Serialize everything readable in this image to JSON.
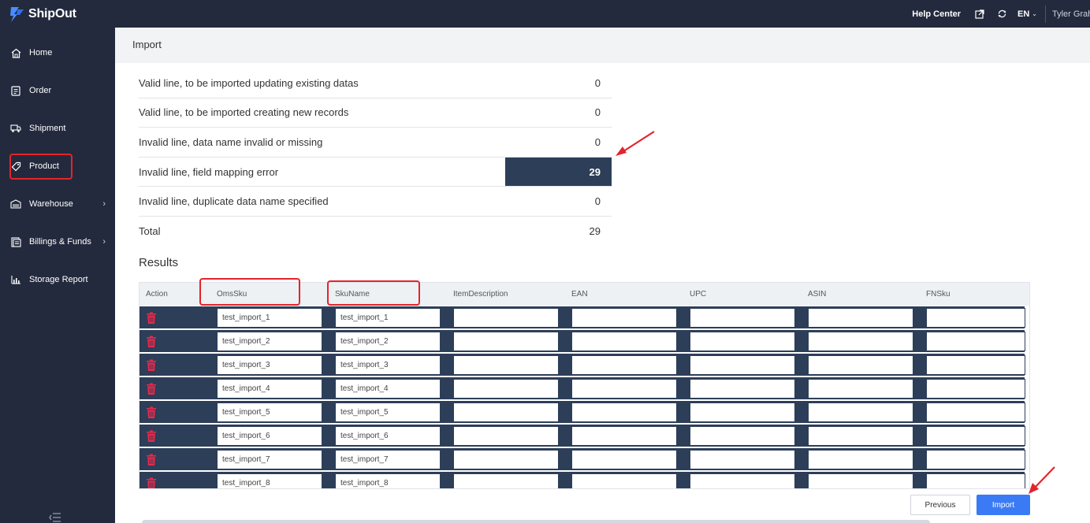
{
  "topbar": {
    "brand": "ShipOut",
    "help_center": "Help Center",
    "language": "EN",
    "user": "Tyler Graham"
  },
  "sidebar": {
    "items": [
      {
        "label": "Home",
        "icon": "home-icon"
      },
      {
        "label": "Order",
        "icon": "order-icon"
      },
      {
        "label": "Shipment",
        "icon": "shipment-icon"
      },
      {
        "label": "Product",
        "icon": "product-tag-icon"
      },
      {
        "label": "Warehouse",
        "icon": "warehouse-icon",
        "expandable": true
      },
      {
        "label": "Billings & Funds",
        "icon": "billing-icon",
        "expandable": true
      },
      {
        "label": "Storage Report",
        "icon": "storage-report-icon"
      }
    ]
  },
  "page": {
    "title": "Import"
  },
  "summary": [
    {
      "label": "Valid line, to be imported updating existing datas",
      "value": "0"
    },
    {
      "label": "Valid line, to be imported creating new records",
      "value": "0"
    },
    {
      "label": "Invalid line, data name invalid or missing",
      "value": "0"
    },
    {
      "label": "Invalid line, field mapping error",
      "value": "29",
      "active": true
    },
    {
      "label": "Invalid line, duplicate data name specified",
      "value": "0"
    },
    {
      "label": "Total",
      "value": "29"
    }
  ],
  "results": {
    "title": "Results",
    "columns": [
      "Action",
      "OmsSku",
      "SkuName",
      "ItemDescription",
      "EAN",
      "UPC",
      "ASIN",
      "FNSku"
    ],
    "rows": [
      {
        "omssku": "test_import_1",
        "skuname": "test_import_1"
      },
      {
        "omssku": "test_import_2",
        "skuname": "test_import_2"
      },
      {
        "omssku": "test_import_3",
        "skuname": "test_import_3"
      },
      {
        "omssku": "test_import_4",
        "skuname": "test_import_4"
      },
      {
        "omssku": "test_import_5",
        "skuname": "test_import_5"
      },
      {
        "omssku": "test_import_6",
        "skuname": "test_import_6"
      },
      {
        "omssku": "test_import_7",
        "skuname": "test_import_7"
      },
      {
        "omssku": "test_import_8",
        "skuname": "test_import_8"
      }
    ]
  },
  "buttons": {
    "previous": "Previous",
    "import": "Import"
  },
  "colors": {
    "sidebar_bg": "#232a3d",
    "row_bg": "#2d3e58",
    "primary": "#3a7bf5",
    "annotation_red": "#e5232b",
    "trash_red": "#e8294c"
  }
}
